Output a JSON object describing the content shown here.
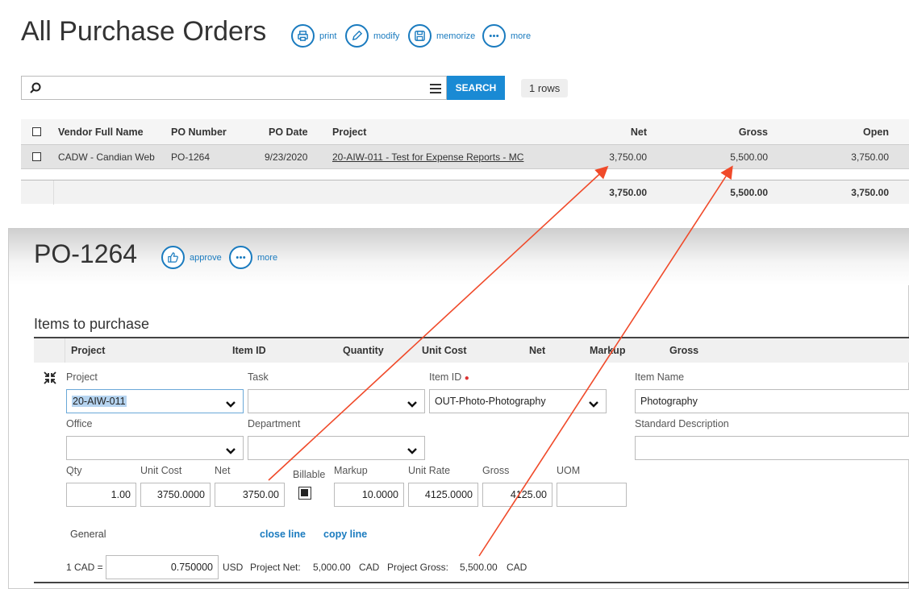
{
  "list": {
    "title": "All Purchase Orders",
    "actions": [
      {
        "label": "print",
        "icon": "printer-icon"
      },
      {
        "label": "modify",
        "icon": "pencil-icon"
      },
      {
        "label": "memorize",
        "icon": "save-icon"
      },
      {
        "label": "more",
        "icon": "ellipsis-icon"
      }
    ],
    "search": {
      "value": "",
      "button": "SEARCH"
    },
    "rows_badge": "1 rows",
    "columns": [
      "Vendor Full Name",
      "PO Number",
      "PO Date",
      "Project",
      "Net",
      "Gross",
      "Open"
    ],
    "row": {
      "vendor": "CADW - Candian Web",
      "po_number": "PO-1264",
      "po_date": "9/23/2020",
      "project": "20-AIW-011 - Test for Expense Reports - MC",
      "net": "3,750.00",
      "gross": "5,500.00",
      "open": "3,750.00"
    },
    "totals": {
      "net": "3,750.00",
      "gross": "5,500.00",
      "open": "3,750.00"
    }
  },
  "detail": {
    "title": "PO-1264",
    "actions": [
      {
        "label": "approve",
        "icon": "thumbs-up-icon"
      },
      {
        "label": "more",
        "icon": "ellipsis-icon"
      }
    ],
    "section_title": "Items to purchase",
    "columns": [
      "Project",
      "Item ID",
      "Quantity",
      "Unit Cost",
      "Net",
      "Markup",
      "Gross"
    ],
    "form": {
      "project_label": "Project",
      "project_value": "20-AIW-011",
      "task_label": "Task",
      "task_value": "",
      "item_id_label": "Item ID",
      "item_id_value": "OUT-Photo-Photography",
      "item_name_label": "Item Name",
      "item_name_value": "Photography",
      "office_label": "Office",
      "office_value": "",
      "department_label": "Department",
      "department_value": "",
      "std_desc_label": "Standard Description",
      "std_desc_value": "",
      "qty_label": "Qty",
      "qty_value": "1.00",
      "unit_cost_label": "Unit Cost",
      "unit_cost_value": "3750.0000",
      "net_label": "Net",
      "net_value": "3750.00",
      "billable_label": "Billable",
      "billable_checked": true,
      "markup_label": "Markup",
      "markup_value": "10.0000",
      "unit_rate_label": "Unit Rate",
      "unit_rate_value": "4125.0000",
      "gross_label": "Gross",
      "gross_value": "4125.00",
      "uom_label": "UOM",
      "uom_value": ""
    },
    "general_label": "General",
    "close_line": "close line",
    "copy_line": "copy line",
    "currency": {
      "prefix": "1 CAD =",
      "rate": "0.750000",
      "suffix": "USD",
      "project_net_label": "Project Net:",
      "project_net_value": "5,000.00",
      "project_net_currency": "CAD",
      "project_gross_label": "Project Gross:",
      "project_gross_value": "5,500.00",
      "project_gross_currency": "CAD"
    }
  },
  "colors": {
    "accent": "#1a7bbf",
    "button": "#1a8ad4",
    "arrow": "#f04a2a",
    "row_selected": "#e3e3e3"
  }
}
